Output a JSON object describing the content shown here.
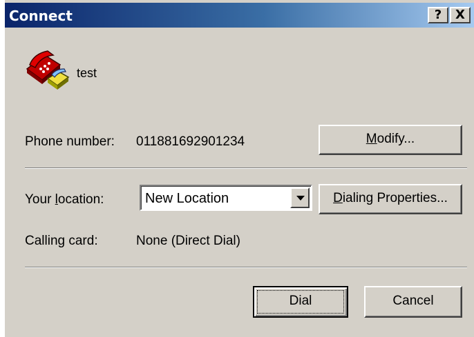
{
  "window": {
    "title": "Connect",
    "help_label": "?",
    "close_label": "X"
  },
  "entry": {
    "name": "test",
    "icon": "phone-icon"
  },
  "phone": {
    "label": "Phone number:",
    "value": "011881692901234",
    "modify_prefix": "",
    "modify_mnemonic": "M",
    "modify_rest": "odify..."
  },
  "location": {
    "label_prefix": "Your ",
    "label_mnemonic": "l",
    "label_rest": "ocation:",
    "selected": "New Location",
    "dialing_mnemonic": "D",
    "dialing_rest": "ialing Properties..."
  },
  "calling_card": {
    "label": "Calling card:",
    "value": "None (Direct Dial)"
  },
  "buttons": {
    "dial": "Dial",
    "cancel": "Cancel"
  },
  "colors": {
    "face": "#d4d0c8",
    "title_start": "#0a246a",
    "title_end": "#a6caf0"
  }
}
